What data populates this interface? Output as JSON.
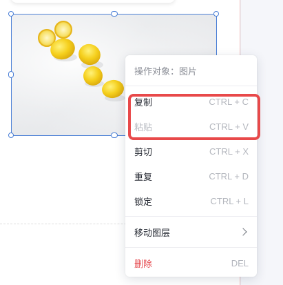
{
  "context_menu": {
    "header": "操作对象：图片",
    "items": [
      {
        "label": "复制",
        "shortcut": "CTRL + C"
      },
      {
        "label": "粘贴",
        "shortcut": "CTRL + V"
      },
      {
        "label": "剪切",
        "shortcut": "CTRL + X"
      },
      {
        "label": "重复",
        "shortcut": "CTRL + D"
      },
      {
        "label": "锁定",
        "shortcut": "CTRL + L"
      },
      {
        "label": "移动图层",
        "shortcut": ""
      },
      {
        "label": "删除",
        "shortcut": "DEL"
      }
    ]
  },
  "colors": {
    "selection": "#4a7fd6",
    "highlight": "#e8494a",
    "danger": "#e5484d",
    "disabled": "#b8bbc2"
  },
  "icons": {
    "submenu": "chevron-right-icon"
  }
}
